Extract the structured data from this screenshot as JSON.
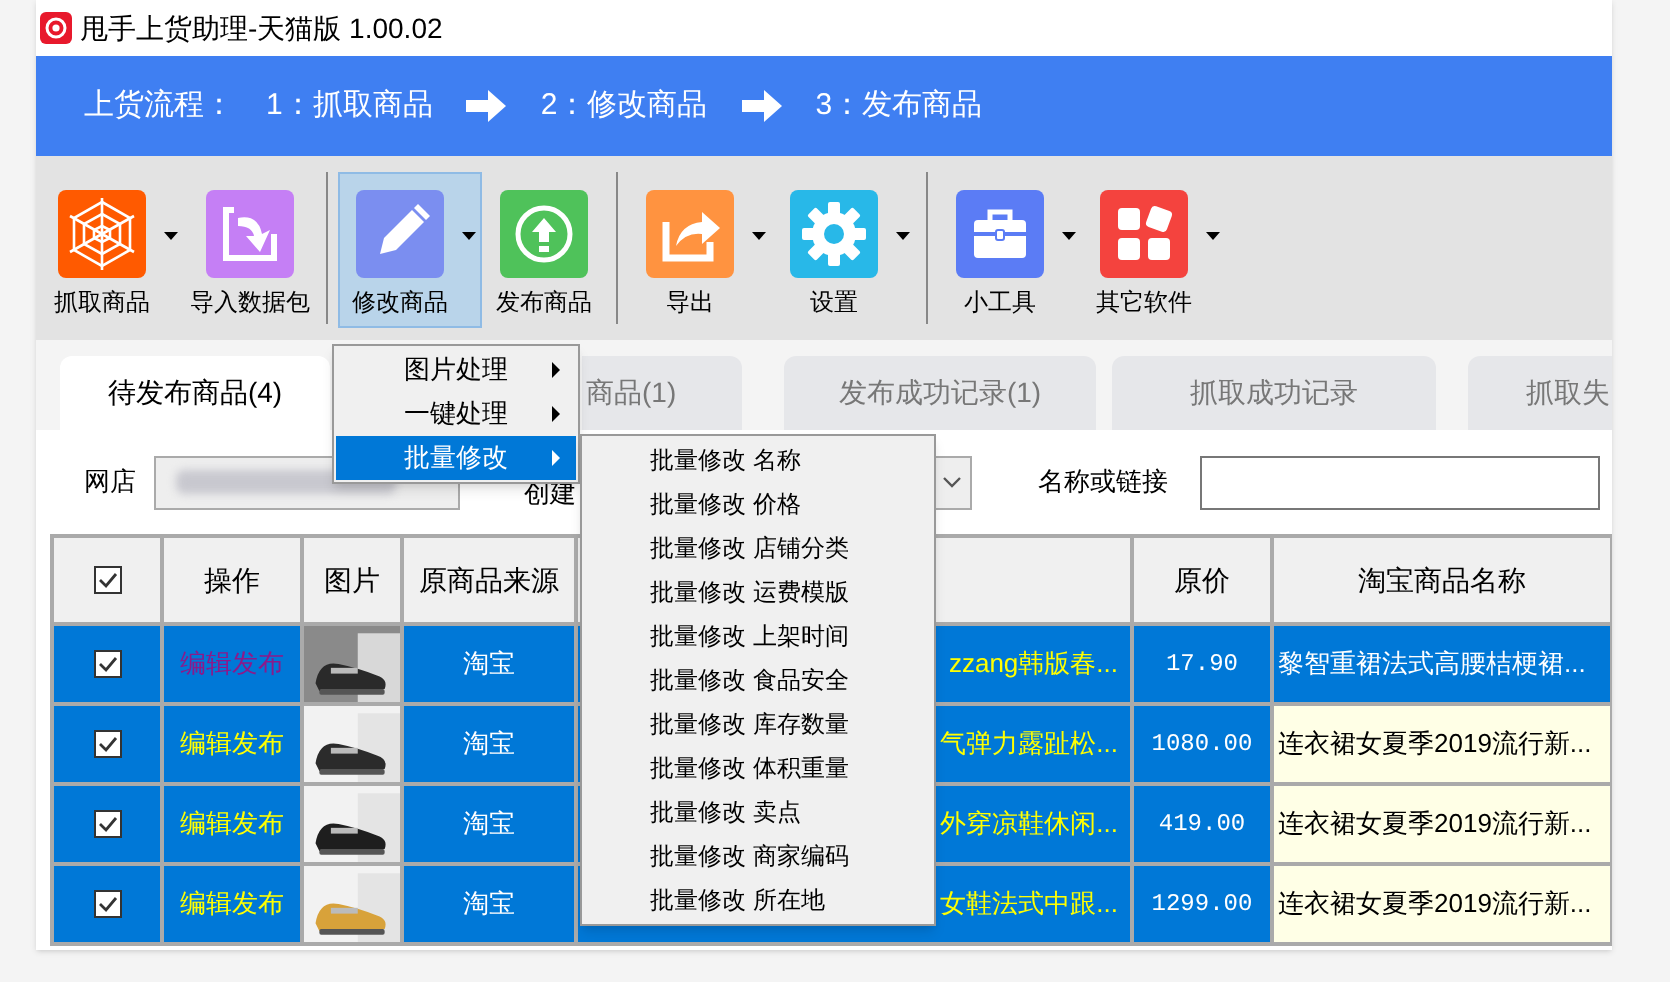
{
  "window": {
    "title": "甩手上货助理-天猫版 1.00.02"
  },
  "flow": {
    "label": "上货流程：",
    "steps": [
      "1：抓取商品",
      "2：修改商品",
      "3：发布商品"
    ]
  },
  "toolbar": [
    {
      "kind": "button",
      "label": "抓取商品",
      "dropdown": true,
      "pressed": false
    },
    {
      "kind": "button",
      "label": "导入数据包",
      "dropdown": false,
      "pressed": false
    },
    {
      "kind": "separator"
    },
    {
      "kind": "button",
      "label": "修改商品",
      "dropdown": true,
      "pressed": true
    },
    {
      "kind": "button",
      "label": "发布商品",
      "dropdown": false,
      "pressed": false
    },
    {
      "kind": "separator"
    },
    {
      "kind": "button",
      "label": "导出",
      "dropdown": true,
      "pressed": false
    },
    {
      "kind": "button",
      "label": "设置",
      "dropdown": true,
      "pressed": false
    },
    {
      "kind": "separator"
    },
    {
      "kind": "button",
      "label": "小工具",
      "dropdown": true,
      "pressed": false
    },
    {
      "kind": "button",
      "label": "其它软件",
      "dropdown": true,
      "pressed": false
    }
  ],
  "tabs": [
    {
      "label": "待发布商品(4)",
      "selected": true
    },
    {
      "label": "商品(1)",
      "selected": false
    },
    {
      "label": "发布成功记录(1)",
      "selected": false
    },
    {
      "label": "抓取成功记录",
      "selected": false
    },
    {
      "label": "抓取失",
      "selected": false
    }
  ],
  "filters": {
    "shop_label": "网店",
    "created_label": "创建",
    "name_label": "名称或链接"
  },
  "table": {
    "header_checked": true,
    "columns": [
      {
        "kind": "check"
      },
      {
        "kind": "text",
        "label": "操作"
      },
      {
        "kind": "text",
        "label": "图片"
      },
      {
        "kind": "text",
        "label": "原商品来源"
      },
      {
        "kind": "blank"
      },
      {
        "kind": "text",
        "label": "原价"
      },
      {
        "kind": "text",
        "label": "淘宝商品名称"
      }
    ],
    "rows": [
      {
        "checked": true,
        "current": true,
        "action": "编辑发布",
        "visited": true,
        "source": "淘宝",
        "title": "zzang韩版春...",
        "price": "17.90",
        "taobao_name": "黎智重裙法式高腰桔梗裙..."
      },
      {
        "checked": true,
        "current": false,
        "action": "编辑发布",
        "visited": false,
        "source": "淘宝",
        "title": "气弹力露趾松...",
        "price": "1080.00",
        "taobao_name": "连衣裙女夏季2019流行新..."
      },
      {
        "checked": true,
        "current": false,
        "action": "编辑发布",
        "visited": false,
        "source": "淘宝",
        "title": "外穿凉鞋休闲...",
        "price": "419.00",
        "taobao_name": "连衣裙女夏季2019流行新..."
      },
      {
        "checked": true,
        "current": false,
        "action": "编辑发布",
        "visited": false,
        "source": "淘宝",
        "title": "女鞋法式中跟...",
        "price": "1299.00",
        "taobao_name": "连衣裙女夏季2019流行新..."
      }
    ]
  },
  "menu": {
    "items": [
      {
        "label": "图片处理",
        "submenu": true,
        "selected": false
      },
      {
        "label": "一键处理",
        "submenu": true,
        "selected": false
      },
      {
        "label": "批量修改",
        "submenu": true,
        "selected": true
      }
    ]
  },
  "submenu": {
    "items": [
      "批量修改 名称",
      "批量修改 价格",
      "批量修改 店铺分类",
      "批量修改 运费模版",
      "批量修改 上架时间",
      "批量修改 食品安全",
      "批量修改 库存数量",
      "批量修改 体积重量",
      "批量修改 卖点",
      "批量修改 商家编码",
      "批量修改 所在地"
    ]
  }
}
